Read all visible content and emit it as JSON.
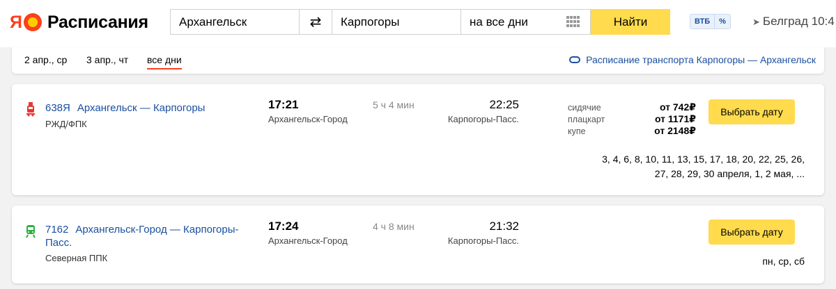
{
  "header": {
    "logo_ya": "Я",
    "logo_text": "Расписания",
    "from_value": "Архангельск",
    "swap_symbol": "⇄",
    "to_value": "Карпогоры",
    "date_value": "на все дни",
    "find_label": "Найти",
    "vtb_label": "ВТБ",
    "vtb_pct": "%",
    "geo_text": "Белград 10:4"
  },
  "tabs": {
    "items": [
      "2 апр., ср",
      "3 апр., чт",
      "все дни"
    ],
    "active_index": 2,
    "reverse_link": "Расписание транспорта Карпогоры — Архангельск"
  },
  "trips": [
    {
      "number": "638Я",
      "route": "Архангельск — Карпогоры",
      "carrier": "РЖД/ФПК",
      "dep_time": "17:21",
      "dep_station": "Архангельск-Город",
      "duration": "5 ч 4 мин",
      "arr_time": "22:25",
      "arr_station": "Карпогоры-Пасс.",
      "icon_color": "#e53935",
      "prices": [
        {
          "cls": "сидячие",
          "val": "от 742₽"
        },
        {
          "cls": "плацкарт",
          "val": "от 1171₽"
        },
        {
          "cls": "купе",
          "val": "от 2148₽"
        }
      ],
      "button_label": "Выбрать дату",
      "days_line1": "3, 4, 6, 8, 10, 11, 13, 15, 17, 18, 20, 22, 25, 26,",
      "days_line2": "27, 28, 29, 30 апреля, 1, 2 мая, ..."
    },
    {
      "number": "7162",
      "route": "Архангельск-Город — Карпогоры-Пасс.",
      "carrier": "Северная ППК",
      "dep_time": "17:24",
      "dep_station": "Архангельск-Город",
      "duration": "4 ч 8 мин",
      "arr_time": "21:32",
      "arr_station": "Карпогоры-Пасс.",
      "icon_color": "#2db040",
      "button_label": "Выбрать дату",
      "days": "пн, ср, сб"
    }
  ]
}
